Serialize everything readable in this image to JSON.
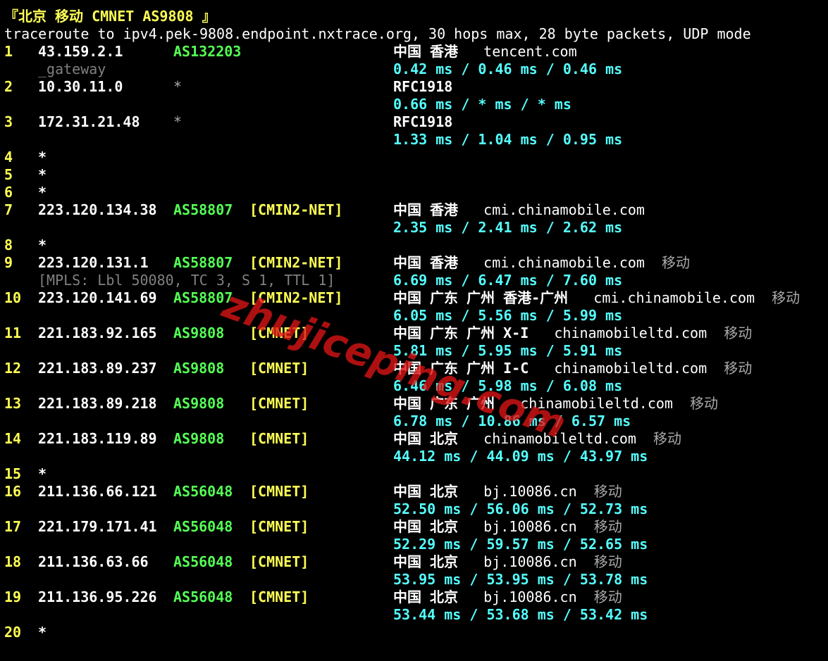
{
  "header": {
    "title": "『北京 移动 CMNET AS9808 』",
    "command": "traceroute to ipv4.pek-9808.endpoint.nxtrace.org, 30 hops max, 28 byte packets, UDP mode"
  },
  "watermark": "zhujiceping.com",
  "colors": {
    "background": "#000000",
    "hop_number": "#ffff55",
    "asn": "#55ff55",
    "tag": "#ffff55",
    "rtt": "#55ffff",
    "dim": "#808080"
  },
  "hops": [
    {
      "num": "1",
      "ip": "43.159.2.1",
      "asn": "AS132203",
      "tag": "",
      "loc": "中国 香港",
      "host": "tencent.com",
      "isp": "",
      "rtt": "0.42 ms / 0.46 ms / 0.46 ms",
      "sub": "_gateway"
    },
    {
      "num": "2",
      "ip": "10.30.11.0",
      "asn": "*",
      "tag": "",
      "loc": "RFC1918",
      "host": "",
      "isp": "",
      "rtt": "0.66 ms / * ms / * ms",
      "sub": ""
    },
    {
      "num": "3",
      "ip": "172.31.21.48",
      "asn": "*",
      "tag": "",
      "loc": "RFC1918",
      "host": "",
      "isp": "",
      "rtt": "1.33 ms / 1.04 ms / 0.95 ms",
      "sub": ""
    },
    {
      "num": "4",
      "ip": "*"
    },
    {
      "num": "5",
      "ip": "*"
    },
    {
      "num": "6",
      "ip": "*"
    },
    {
      "num": "7",
      "ip": "223.120.134.38",
      "asn": "AS58807",
      "tag": "[CMIN2-NET]",
      "loc": "中国 香港",
      "host": "cmi.chinamobile.com",
      "isp": "",
      "rtt": "2.35 ms / 2.41 ms / 2.62 ms",
      "sub": ""
    },
    {
      "num": "8",
      "ip": "*"
    },
    {
      "num": "9",
      "ip": "223.120.131.1",
      "asn": "AS58807",
      "tag": "[CMIN2-NET]",
      "loc": "中国 香港",
      "host": "cmi.chinamobile.com",
      "isp": "移动",
      "rtt": "6.69 ms / 6.47 ms / 7.60 ms",
      "sub": "[MPLS: Lbl 50080, TC 3, S 1, TTL 1]"
    },
    {
      "num": "10",
      "ip": "223.120.141.69",
      "asn": "AS58807",
      "tag": "[CMIN2-NET]",
      "loc": "中国 广东 广州 香港-广州",
      "host": "cmi.chinamobile.com",
      "isp": "移动",
      "rtt": "6.05 ms / 5.56 ms / 5.99 ms",
      "sub": ""
    },
    {
      "num": "11",
      "ip": "221.183.92.165",
      "asn": "AS9808",
      "tag": "[CMNET]",
      "loc": "中国 广东 广州 X-I",
      "host": "chinamobileltd.com",
      "isp": "移动",
      "rtt": "5.81 ms / 5.95 ms / 5.91 ms",
      "sub": ""
    },
    {
      "num": "12",
      "ip": "221.183.89.237",
      "asn": "AS9808",
      "tag": "[CMNET]",
      "loc": "中国 广东 广州 I-C",
      "host": "chinamobileltd.com",
      "isp": "移动",
      "rtt": "6.46 ms / 5.98 ms / 6.08 ms",
      "sub": ""
    },
    {
      "num": "13",
      "ip": "221.183.89.218",
      "asn": "AS9808",
      "tag": "[CMNET]",
      "loc": "中国 广东 广州",
      "host": "chinamobileltd.com",
      "isp": "移动",
      "rtt": "6.78 ms / 10.86 ms / 6.57 ms",
      "sub": ""
    },
    {
      "num": "14",
      "ip": "221.183.119.89",
      "asn": "AS9808",
      "tag": "[CMNET]",
      "loc": "中国 北京",
      "host": "chinamobileltd.com",
      "isp": "移动",
      "rtt": "44.12 ms / 44.09 ms / 43.97 ms",
      "sub": ""
    },
    {
      "num": "15",
      "ip": "*"
    },
    {
      "num": "16",
      "ip": "211.136.66.121",
      "asn": "AS56048",
      "tag": "[CMNET]",
      "loc": "中国 北京",
      "host": "bj.10086.cn",
      "isp": "移动",
      "rtt": "52.50 ms / 56.06 ms / 52.73 ms",
      "sub": ""
    },
    {
      "num": "17",
      "ip": "221.179.171.41",
      "asn": "AS56048",
      "tag": "[CMNET]",
      "loc": "中国 北京",
      "host": "bj.10086.cn",
      "isp": "移动",
      "rtt": "52.29 ms / 59.57 ms / 52.65 ms",
      "sub": ""
    },
    {
      "num": "18",
      "ip": "211.136.63.66",
      "asn": "AS56048",
      "tag": "[CMNET]",
      "loc": "中国 北京",
      "host": "bj.10086.cn",
      "isp": "移动",
      "rtt": "53.95 ms / 53.95 ms / 53.78 ms",
      "sub": ""
    },
    {
      "num": "19",
      "ip": "211.136.95.226",
      "asn": "AS56048",
      "tag": "[CMNET]",
      "loc": "中国 北京",
      "host": "bj.10086.cn",
      "isp": "移动",
      "rtt": "53.44 ms / 53.68 ms / 53.42 ms",
      "sub": ""
    },
    {
      "num": "20",
      "ip": "*"
    }
  ]
}
